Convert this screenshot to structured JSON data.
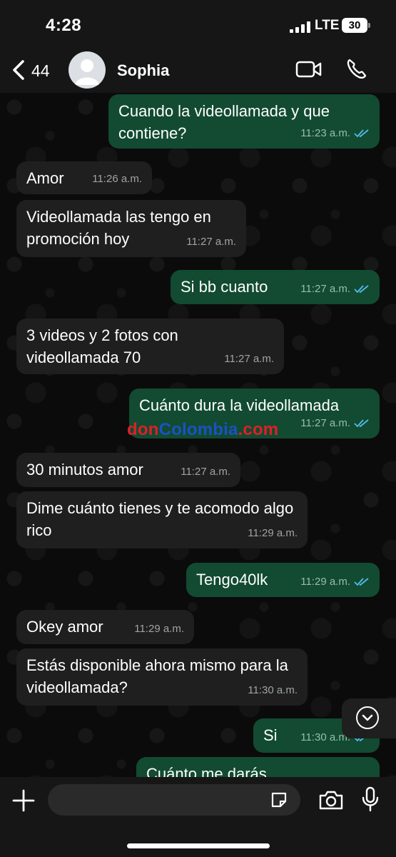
{
  "status_bar": {
    "time": "4:28",
    "network": "LTE",
    "battery": "30"
  },
  "header": {
    "back_count": "44",
    "contact_name": "Sophia"
  },
  "messages": [
    {
      "dir": "out",
      "text": "Cuando la videollamada y que contiene?",
      "time": "11:23 a.m."
    },
    {
      "dir": "in",
      "text": "Amor",
      "time": "11:26 a.m."
    },
    {
      "dir": "in",
      "text": "Videollamada las tengo en promoción hoy",
      "time": "11:27 a.m."
    },
    {
      "dir": "out",
      "text": "Si bb cuanto",
      "time": "11:27 a.m."
    },
    {
      "dir": "in",
      "text": "3 videos y 2 fotos con videollamada 70",
      "time": "11:27 a.m."
    },
    {
      "dir": "out",
      "text": "Cuánto dura la videollamada",
      "time": "11:27 a.m."
    },
    {
      "dir": "in",
      "text": "30 minutos amor",
      "time": "11:27 a.m."
    },
    {
      "dir": "in",
      "text": "Dime cuánto tienes y te acomodo algo rico",
      "time": "11:29 a.m."
    },
    {
      "dir": "out",
      "text": "Tengo40lk",
      "time": "11:29 a.m."
    },
    {
      "dir": "in",
      "text": "Okey amor",
      "time": "11:29 a.m."
    },
    {
      "dir": "in",
      "text": "Estás disponible ahora mismo para la videollamada?",
      "time": "11:30 a.m."
    },
    {
      "dir": "out",
      "text": "Si",
      "time": "11:30 a.m."
    },
    {
      "dir": "out",
      "text": "Cuánto me darás",
      "time": ""
    }
  ],
  "watermark": {
    "part1": "don",
    "part2": "Colombia",
    "part3": ".com"
  },
  "input_bar": {
    "placeholder": ""
  },
  "colors": {
    "outgoing_bubble": "#124b32",
    "incoming_bubble": "#1f1f1f",
    "read_ticks": "#53bdeb"
  }
}
